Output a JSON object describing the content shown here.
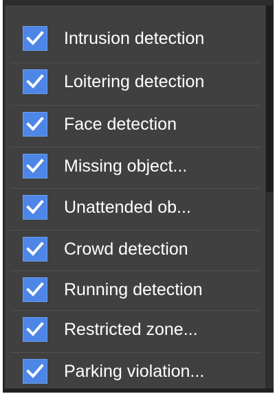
{
  "options": [
    {
      "label": "Intrusion detection",
      "checked": true
    },
    {
      "label": "Loitering detection",
      "checked": true
    },
    {
      "label": "Face detection",
      "checked": true
    },
    {
      "label": "Missing object...",
      "checked": true
    },
    {
      "label": "Unattended ob...",
      "checked": true
    },
    {
      "label": "Crowd detection",
      "checked": true
    },
    {
      "label": "Running detection",
      "checked": true
    },
    {
      "label": "Restricted zone...",
      "checked": true
    },
    {
      "label": "Parking violation...",
      "checked": true
    }
  ],
  "colors": {
    "panel_background": "#3f403f",
    "checkbox_fill": "#4d86e6",
    "checkmark": "#ffffff",
    "label_text": "#ffffff"
  }
}
